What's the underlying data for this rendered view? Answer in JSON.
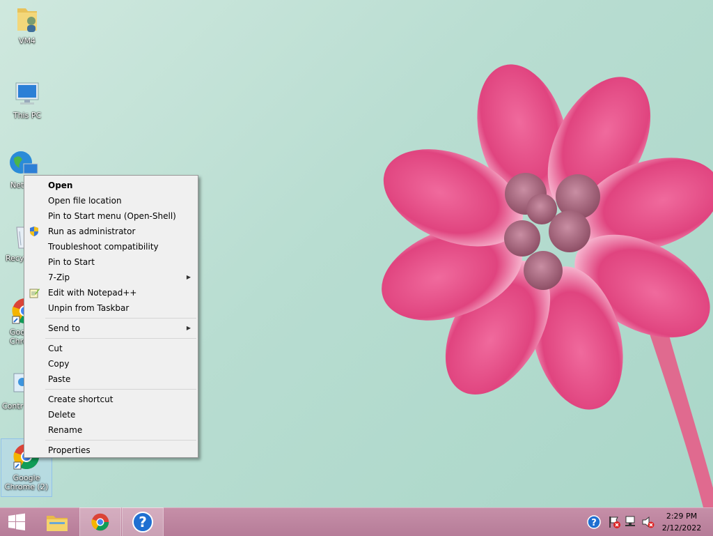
{
  "desktop": {
    "icons": [
      {
        "label": "VM4"
      },
      {
        "label": "This PC"
      },
      {
        "label": "Net"
      },
      {
        "label": "Recy"
      },
      {
        "label": "Goo Chro"
      },
      {
        "label": "Contr"
      },
      {
        "label": "Google Chrome (2)"
      }
    ]
  },
  "context_menu": {
    "items": [
      {
        "label": "Open"
      },
      {
        "label": "Open file location"
      },
      {
        "label": "Pin to Start menu (Open-Shell)"
      },
      {
        "label": "Run as administrator",
        "icon": "uac-shield-icon"
      },
      {
        "label": "Troubleshoot compatibility"
      },
      {
        "label": "Pin to Start"
      },
      {
        "label": "7-Zip",
        "submenu": true
      },
      {
        "label": "Edit with Notepad++",
        "icon": "notepad-plus-plus-icon"
      },
      {
        "label": "Unpin from Taskbar"
      },
      {
        "label": "Send to",
        "submenu": true
      },
      {
        "label": "Cut"
      },
      {
        "label": "Copy"
      },
      {
        "label": "Paste"
      },
      {
        "label": "Create shortcut"
      },
      {
        "label": "Delete"
      },
      {
        "label": "Rename"
      },
      {
        "label": "Properties"
      }
    ]
  },
  "taskbar": {
    "buttons": [
      "start-button",
      "file-explorer",
      "google-chrome",
      "help-and-support"
    ],
    "clock": {
      "time": "2:29 PM",
      "date": "2/12/2022"
    }
  },
  "colors": {
    "taskbar": "#b67c98",
    "menu_background": "#f0f0f0",
    "flower": "#e0447f"
  }
}
